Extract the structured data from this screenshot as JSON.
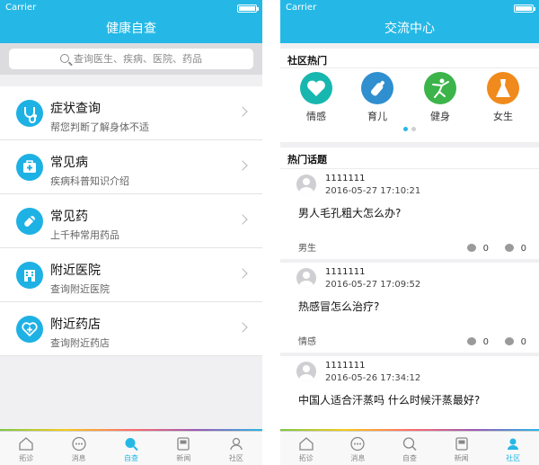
{
  "left": {
    "status": {
      "carrier": "Carrier"
    },
    "title": "健康自查",
    "search": {
      "placeholder": "查询医生、疾病、医院、药品"
    },
    "menu": [
      {
        "title": "症状查询",
        "sub": "帮您判断了解身体不适",
        "icon": "stethoscope-icon"
      },
      {
        "title": "常见病",
        "sub": "疾病科普知识介绍",
        "icon": "medical-kit-icon"
      },
      {
        "title": "常见药",
        "sub": "上千种常用药品",
        "icon": "pill-icon"
      },
      {
        "title": "附近医院",
        "sub": "查询附近医院",
        "icon": "hospital-icon"
      },
      {
        "title": "附近药店",
        "sub": "查询附近药店",
        "icon": "pharmacy-icon"
      }
    ],
    "tabs": [
      {
        "label": "拓诊",
        "icon": "home-icon"
      },
      {
        "label": "消息",
        "icon": "message-icon"
      },
      {
        "label": "自查",
        "icon": "search-icon"
      },
      {
        "label": "新闻",
        "icon": "news-icon"
      },
      {
        "label": "社区",
        "icon": "community-icon"
      }
    ],
    "active_tab": "自查"
  },
  "right": {
    "status": {
      "carrier": "Carrier"
    },
    "title": "交流中心",
    "hot_section": "社区热门",
    "hot_items": [
      {
        "label": "情感",
        "icon": "heart-icon",
        "color": "#17b7b0"
      },
      {
        "label": "育儿",
        "icon": "baby-bottle-icon",
        "color": "#2f8fcf"
      },
      {
        "label": "健身",
        "icon": "fitness-icon",
        "color": "#3cb44a"
      },
      {
        "label": "女生",
        "icon": "dress-icon",
        "color": "#f08a1c"
      }
    ],
    "topics_section": "热门话题",
    "posts": [
      {
        "user": "1111111",
        "time": "2016-05-27 17:10:21",
        "title": "男人毛孔粗大怎么办?",
        "category": "男生",
        "replies": "0",
        "views": "0"
      },
      {
        "user": "1111111",
        "time": "2016-05-27 17:09:52",
        "title": "热感冒怎么治疗?",
        "category": "情感",
        "replies": "0",
        "views": "0"
      },
      {
        "user": "1111111",
        "time": "2016-05-26 17:34:12",
        "title": "中国人适合汗蒸吗 什么时候汗蒸最好?",
        "category": "",
        "replies": "",
        "views": ""
      }
    ],
    "tabs": [
      {
        "label": "拓诊",
        "icon": "home-icon"
      },
      {
        "label": "消息",
        "icon": "message-icon"
      },
      {
        "label": "自查",
        "icon": "search-icon"
      },
      {
        "label": "新闻",
        "icon": "news-icon"
      },
      {
        "label": "社区",
        "icon": "community-icon"
      }
    ],
    "active_tab": "社区"
  }
}
